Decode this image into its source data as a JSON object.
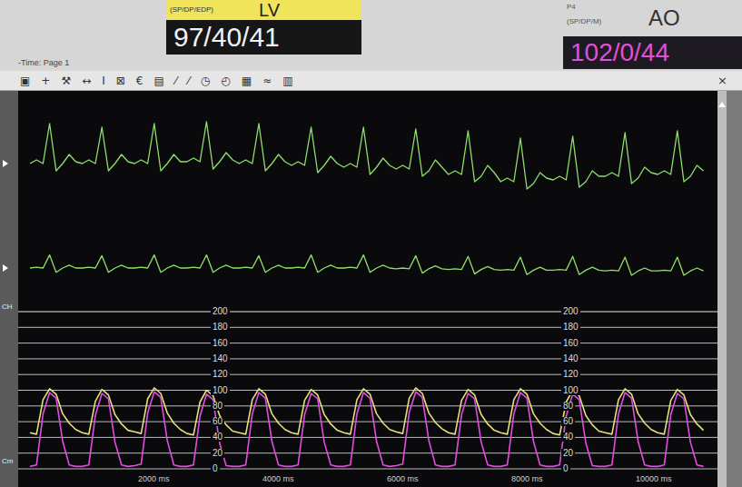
{
  "header": {
    "left": {
      "legend": "(SP/DP/EDP)",
      "label": "LV",
      "reading": "97/40/41"
    },
    "right": {
      "channel": "P4",
      "legend": "(SP/DP/M)",
      "label": "AO",
      "reading": "102/0/44"
    },
    "page_title": "-Time: Page 1"
  },
  "toolbar": {
    "icons": [
      "▣",
      "+",
      "⚒",
      "↔",
      "Ι",
      "⊠",
      "€",
      "▤",
      "⁄",
      "⁄",
      "◷",
      "◴",
      "▦",
      "≈",
      "▥"
    ],
    "close": "×"
  },
  "channel_labels": [
    {
      "text": "CH",
      "position": "top"
    },
    {
      "text": "Cm",
      "position": "bottom"
    }
  ],
  "ecg": [
    {
      "name": "ecg-lead-1",
      "color": "#8fe06a",
      "values": [
        0,
        0.1,
        0,
        1.1,
        -0.2,
        0,
        0.25,
        0.05,
        0,
        0.1,
        0,
        1.0,
        -0.2,
        0,
        0.25,
        0.05,
        0,
        0.1,
        0,
        1.1,
        -0.2,
        0,
        0.25,
        0.05,
        0.05,
        0.15,
        0.05,
        1.15,
        -0.15,
        0.05,
        0.3,
        0.1,
        0,
        0.1,
        0,
        1.1,
        -0.2,
        0,
        0.25,
        0.05,
        -0.05,
        0.05,
        -0.05,
        1.0,
        -0.25,
        -0.05,
        0.2,
        0,
        -0.1,
        0,
        -0.1,
        1.0,
        -0.3,
        -0.1,
        0.15,
        -0.05,
        -0.15,
        -0.05,
        -0.15,
        0.95,
        -0.35,
        -0.2,
        0.1,
        -0.1,
        -0.3,
        -0.2,
        -0.3,
        0.9,
        -0.5,
        -0.35,
        -0.05,
        -0.25,
        -0.5,
        -0.4,
        -0.5,
        0.7,
        -0.7,
        -0.55,
        -0.25,
        -0.4,
        -0.45,
        -0.35,
        -0.45,
        0.75,
        -0.65,
        -0.5,
        -0.2,
        -0.35,
        -0.35,
        -0.25,
        -0.35,
        0.85,
        -0.55,
        -0.4,
        -0.1,
        -0.25,
        -0.3,
        -0.2,
        -0.3,
        0.9,
        -0.5,
        -0.35,
        -0.05,
        -0.2
      ]
    },
    {
      "name": "ecg-lead-2",
      "color": "#8fe06a",
      "values": [
        0,
        0.05,
        0,
        0.9,
        -0.3,
        0,
        0.2,
        0,
        0,
        0.05,
        0,
        0.85,
        -0.3,
        0,
        0.2,
        0,
        0,
        0.05,
        0,
        0.9,
        -0.3,
        0,
        0.2,
        0,
        0,
        0.05,
        0,
        0.9,
        -0.3,
        0,
        0.2,
        0,
        0,
        0.05,
        0,
        0.85,
        -0.3,
        0,
        0.2,
        0,
        0,
        0.05,
        0,
        0.9,
        -0.3,
        0,
        0.2,
        0,
        0,
        0.05,
        0,
        0.9,
        -0.3,
        0,
        0.2,
        0,
        -0.05,
        0,
        -0.05,
        0.85,
        -0.35,
        -0.05,
        0.15,
        -0.05,
        -0.1,
        -0.05,
        -0.1,
        0.8,
        -0.4,
        -0.1,
        0.1,
        -0.1,
        -0.15,
        -0.1,
        -0.15,
        0.75,
        -0.45,
        -0.15,
        0.05,
        -0.15,
        -0.15,
        -0.1,
        -0.15,
        0.8,
        -0.45,
        -0.15,
        0.05,
        -0.15,
        -0.2,
        -0.15,
        -0.2,
        0.75,
        -0.5,
        -0.2,
        0,
        -0.2,
        -0.2,
        -0.15,
        -0.2,
        0.75,
        -0.5,
        -0.2,
        0,
        -0.2
      ]
    }
  ],
  "pressure_chart": {
    "y_ticks": [
      "200",
      "180",
      "160",
      "140",
      "120",
      "100",
      "80",
      "60",
      "40",
      "20",
      "0"
    ],
    "x_ticks": [
      "2000 ms",
      "4000 ms",
      "6000 ms",
      "8000 ms",
      "10000 ms"
    ],
    "series": [
      {
        "name": "LV",
        "color": "#e44ce4",
        "values": [
          3,
          5,
          70,
          97,
          90,
          35,
          5,
          3,
          3,
          5,
          68,
          96,
          89,
          34,
          5,
          3,
          4,
          6,
          71,
          98,
          91,
          36,
          5,
          3,
          3,
          5,
          67,
          95,
          88,
          33,
          4,
          3,
          3,
          5,
          70,
          97,
          90,
          35,
          5,
          3,
          3,
          5,
          69,
          96,
          89,
          34,
          5,
          3,
          3,
          5,
          70,
          97,
          90,
          35,
          5,
          3,
          4,
          6,
          72,
          98,
          91,
          36,
          5,
          3,
          3,
          5,
          69,
          96,
          89,
          34,
          5,
          3,
          3,
          5,
          70,
          97,
          90,
          35,
          5,
          3,
          3,
          5,
          67,
          95,
          88,
          33,
          4,
          3,
          3,
          5,
          70,
          97,
          90,
          35,
          5,
          3,
          3,
          5,
          69,
          96,
          89,
          34,
          5,
          3
        ]
      },
      {
        "name": "AO",
        "color": "#e6e07a",
        "values": [
          46,
          44,
          88,
          102,
          95,
          70,
          58,
          50,
          46,
          44,
          86,
          101,
          94,
          69,
          57,
          49,
          47,
          45,
          89,
          103,
          96,
          71,
          58,
          50,
          45,
          43,
          85,
          100,
          93,
          68,
          56,
          48,
          46,
          44,
          88,
          102,
          95,
          70,
          58,
          50,
          46,
          44,
          87,
          101,
          94,
          69,
          57,
          49,
          46,
          44,
          88,
          102,
          95,
          70,
          58,
          50,
          47,
          45,
          90,
          103,
          96,
          71,
          59,
          51,
          46,
          44,
          87,
          101,
          94,
          69,
          57,
          49,
          46,
          44,
          88,
          102,
          95,
          70,
          58,
          50,
          45,
          43,
          85,
          100,
          93,
          68,
          56,
          48,
          46,
          44,
          88,
          102,
          95,
          70,
          58,
          50,
          46,
          44,
          87,
          101,
          94,
          69,
          57,
          49
        ]
      }
    ]
  }
}
